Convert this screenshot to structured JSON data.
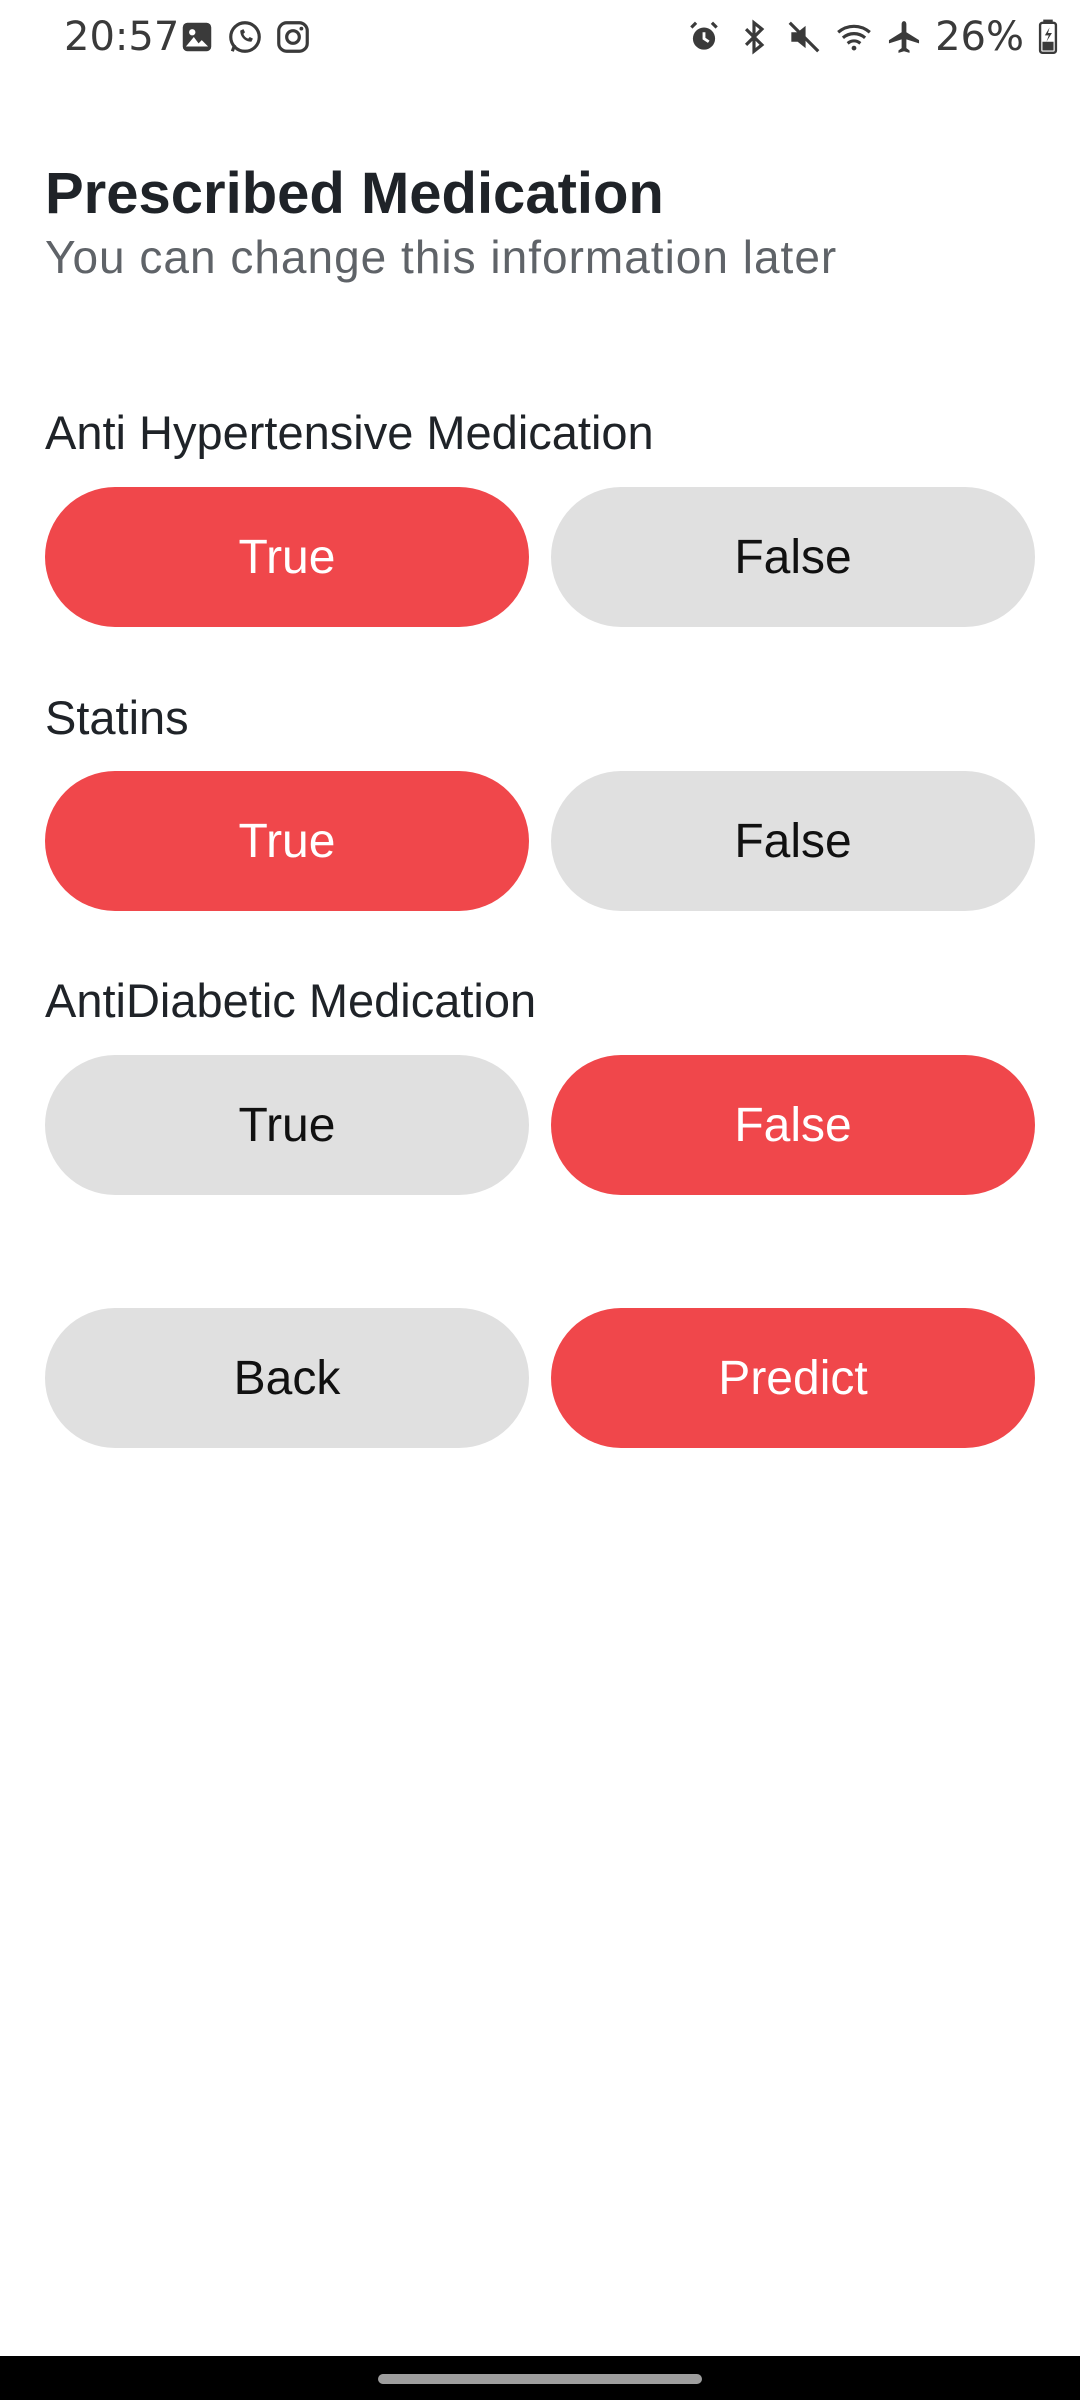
{
  "status_bar": {
    "time": "20:57",
    "left_icons": [
      "image-icon",
      "whatsapp-icon",
      "instagram-icon"
    ],
    "right_icons": [
      "alarm-icon",
      "bluetooth-icon",
      "mute-icon",
      "wifi-icon",
      "airplane-icon"
    ],
    "battery": "26%"
  },
  "header": {
    "title": "Prescribed Medication",
    "subtitle": "You can change this information later"
  },
  "sections": [
    {
      "label": "Anti Hypertensive Medication",
      "true_label": "True",
      "false_label": "False",
      "selected": "True"
    },
    {
      "label": "Statins",
      "true_label": "True",
      "false_label": "False",
      "selected": "True"
    },
    {
      "label": "AntiDiabetic Medication",
      "true_label": "True",
      "false_label": "False",
      "selected": "False"
    }
  ],
  "actions": {
    "back_label": "Back",
    "predict_label": "Predict"
  },
  "colors": {
    "accent": "#f0474b",
    "inactive": "#e0e0e0",
    "title": "#1f2328",
    "subtitle": "#5f6368"
  }
}
